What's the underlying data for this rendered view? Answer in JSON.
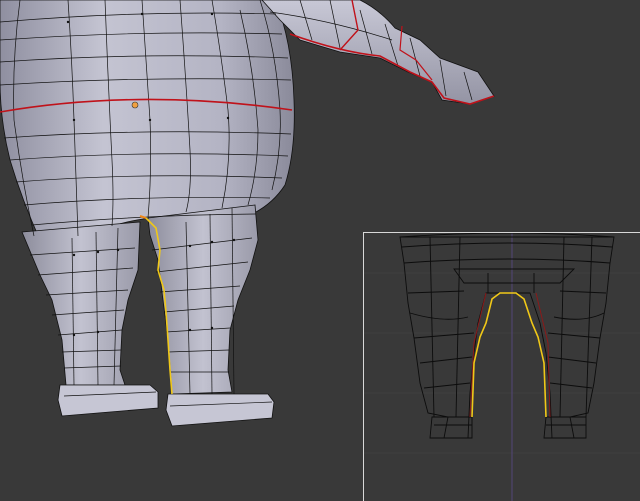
{
  "viewport": {
    "background_color": "#393939",
    "mesh_face_color": "#b9b9c8",
    "mesh_shadow_color": "#7d7d8c",
    "wire_color": "#111111",
    "seam_color": "#c0121a",
    "selected_edge_color": "#f0c818",
    "active_vertex_color": "#f0a040",
    "inset_border_color": "#d8d8d8",
    "inset_background_color": "#393939"
  },
  "objects": {
    "main_view": "3d-viewport-perspective",
    "inset_view": "3d-viewport-wireframe-front"
  }
}
